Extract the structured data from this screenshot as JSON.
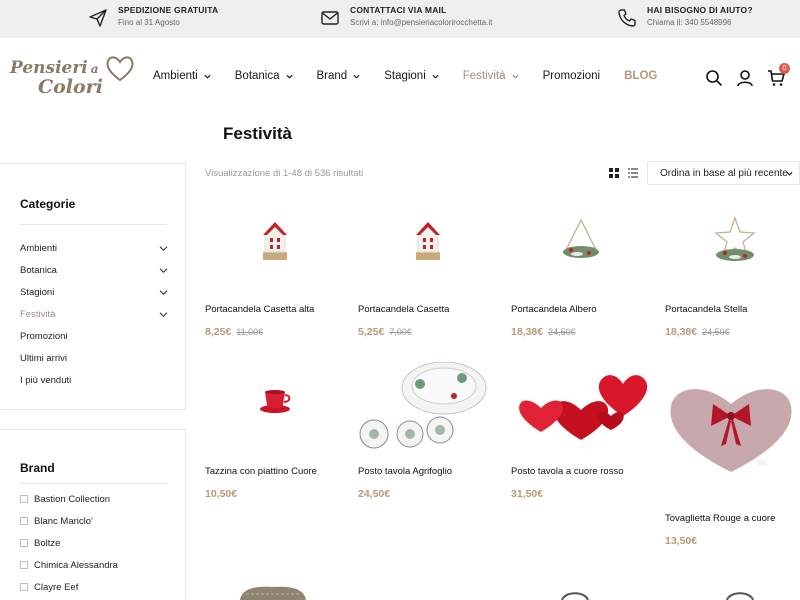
{
  "topbar": {
    "shipping": {
      "title": "SPEDIZIONE GRATUITA",
      "sub": "Fino al 31 Agosto"
    },
    "mail": {
      "title": "CONTATTACI VIA MAIL",
      "sub": "Scrivi a: info@pensieriacolorirocchetta.it"
    },
    "help": {
      "title": "HAI BISOGNO DI AIUTO?",
      "sub": "Chiama il: 340 5548996"
    }
  },
  "logo": {
    "line1": "Pensieri",
    "a": "a",
    "line2": "Colori"
  },
  "nav": [
    {
      "label": "Ambienti",
      "dropdown": true
    },
    {
      "label": "Botanica",
      "dropdown": true
    },
    {
      "label": "Brand",
      "dropdown": true
    },
    {
      "label": "Stagioni",
      "dropdown": true
    },
    {
      "label": "Festività",
      "dropdown": true,
      "active": true
    },
    {
      "label": "Promozioni",
      "dropdown": false
    },
    {
      "label": "BLOG",
      "dropdown": false,
      "blog": true
    }
  ],
  "header": {
    "cart_count": "0",
    "icons": [
      "search-icon",
      "user-icon",
      "cart-icon"
    ]
  },
  "page": {
    "title": "Festività"
  },
  "toolbar": {
    "results": "Visualizzazione di 1-48 di 536 risultati",
    "sort": "Ordina in base al più recente"
  },
  "sidebar": {
    "categories_title": "Categorie",
    "categories": [
      {
        "label": "Ambienti",
        "expand": true
      },
      {
        "label": "Botanica",
        "expand": true
      },
      {
        "label": "Stagioni",
        "expand": true
      },
      {
        "label": "Festività",
        "expand": true,
        "active": true
      },
      {
        "label": "Promozioni",
        "expand": false
      },
      {
        "label": "Ultimi arrivi",
        "expand": false
      },
      {
        "label": "I più venduti",
        "expand": false
      }
    ],
    "brand_title": "Brand",
    "brands": [
      "Bastion Collection",
      "Blanc Mariclo'",
      "Boltze",
      "Chimica Alessandra",
      "Clayre Eef"
    ]
  },
  "products": [
    {
      "name": "Portacandela Casetta alta",
      "price": "8,25€",
      "old": "11,00€",
      "icon": "house-candle-holder"
    },
    {
      "name": "Portacandela Casetta",
      "price": "5,25€",
      "old": "7,00€",
      "icon": "house-candle-holder"
    },
    {
      "name": "Portacandela Albero",
      "price": "18,38€",
      "old": "24,50€",
      "icon": "tree-candle-holder"
    },
    {
      "name": "Portacandela Stella",
      "price": "18,38€",
      "old": "24,50€",
      "icon": "star-candle-holder"
    },
    {
      "name": "Tazzina con piattino Cuore",
      "price": "10,50€",
      "old": "",
      "icon": "red-cup"
    },
    {
      "name": "Posto tavola Agrifoglio",
      "price": "24,50€",
      "old": "",
      "icon": "holly-plates"
    },
    {
      "name": "Posto tavola a cuore rosso",
      "price": "31,50€",
      "old": "",
      "icon": "red-heart-plates"
    },
    {
      "name": "Tovaglietta Rouge a cuore",
      "price": "13,50€",
      "old": "",
      "icon": "heart-placemat"
    }
  ],
  "colors": {
    "accent": "#b79c7a",
    "active_nav": "#9b8f80",
    "topbar_bg": "#efefef",
    "badge": "#e05c4e"
  }
}
